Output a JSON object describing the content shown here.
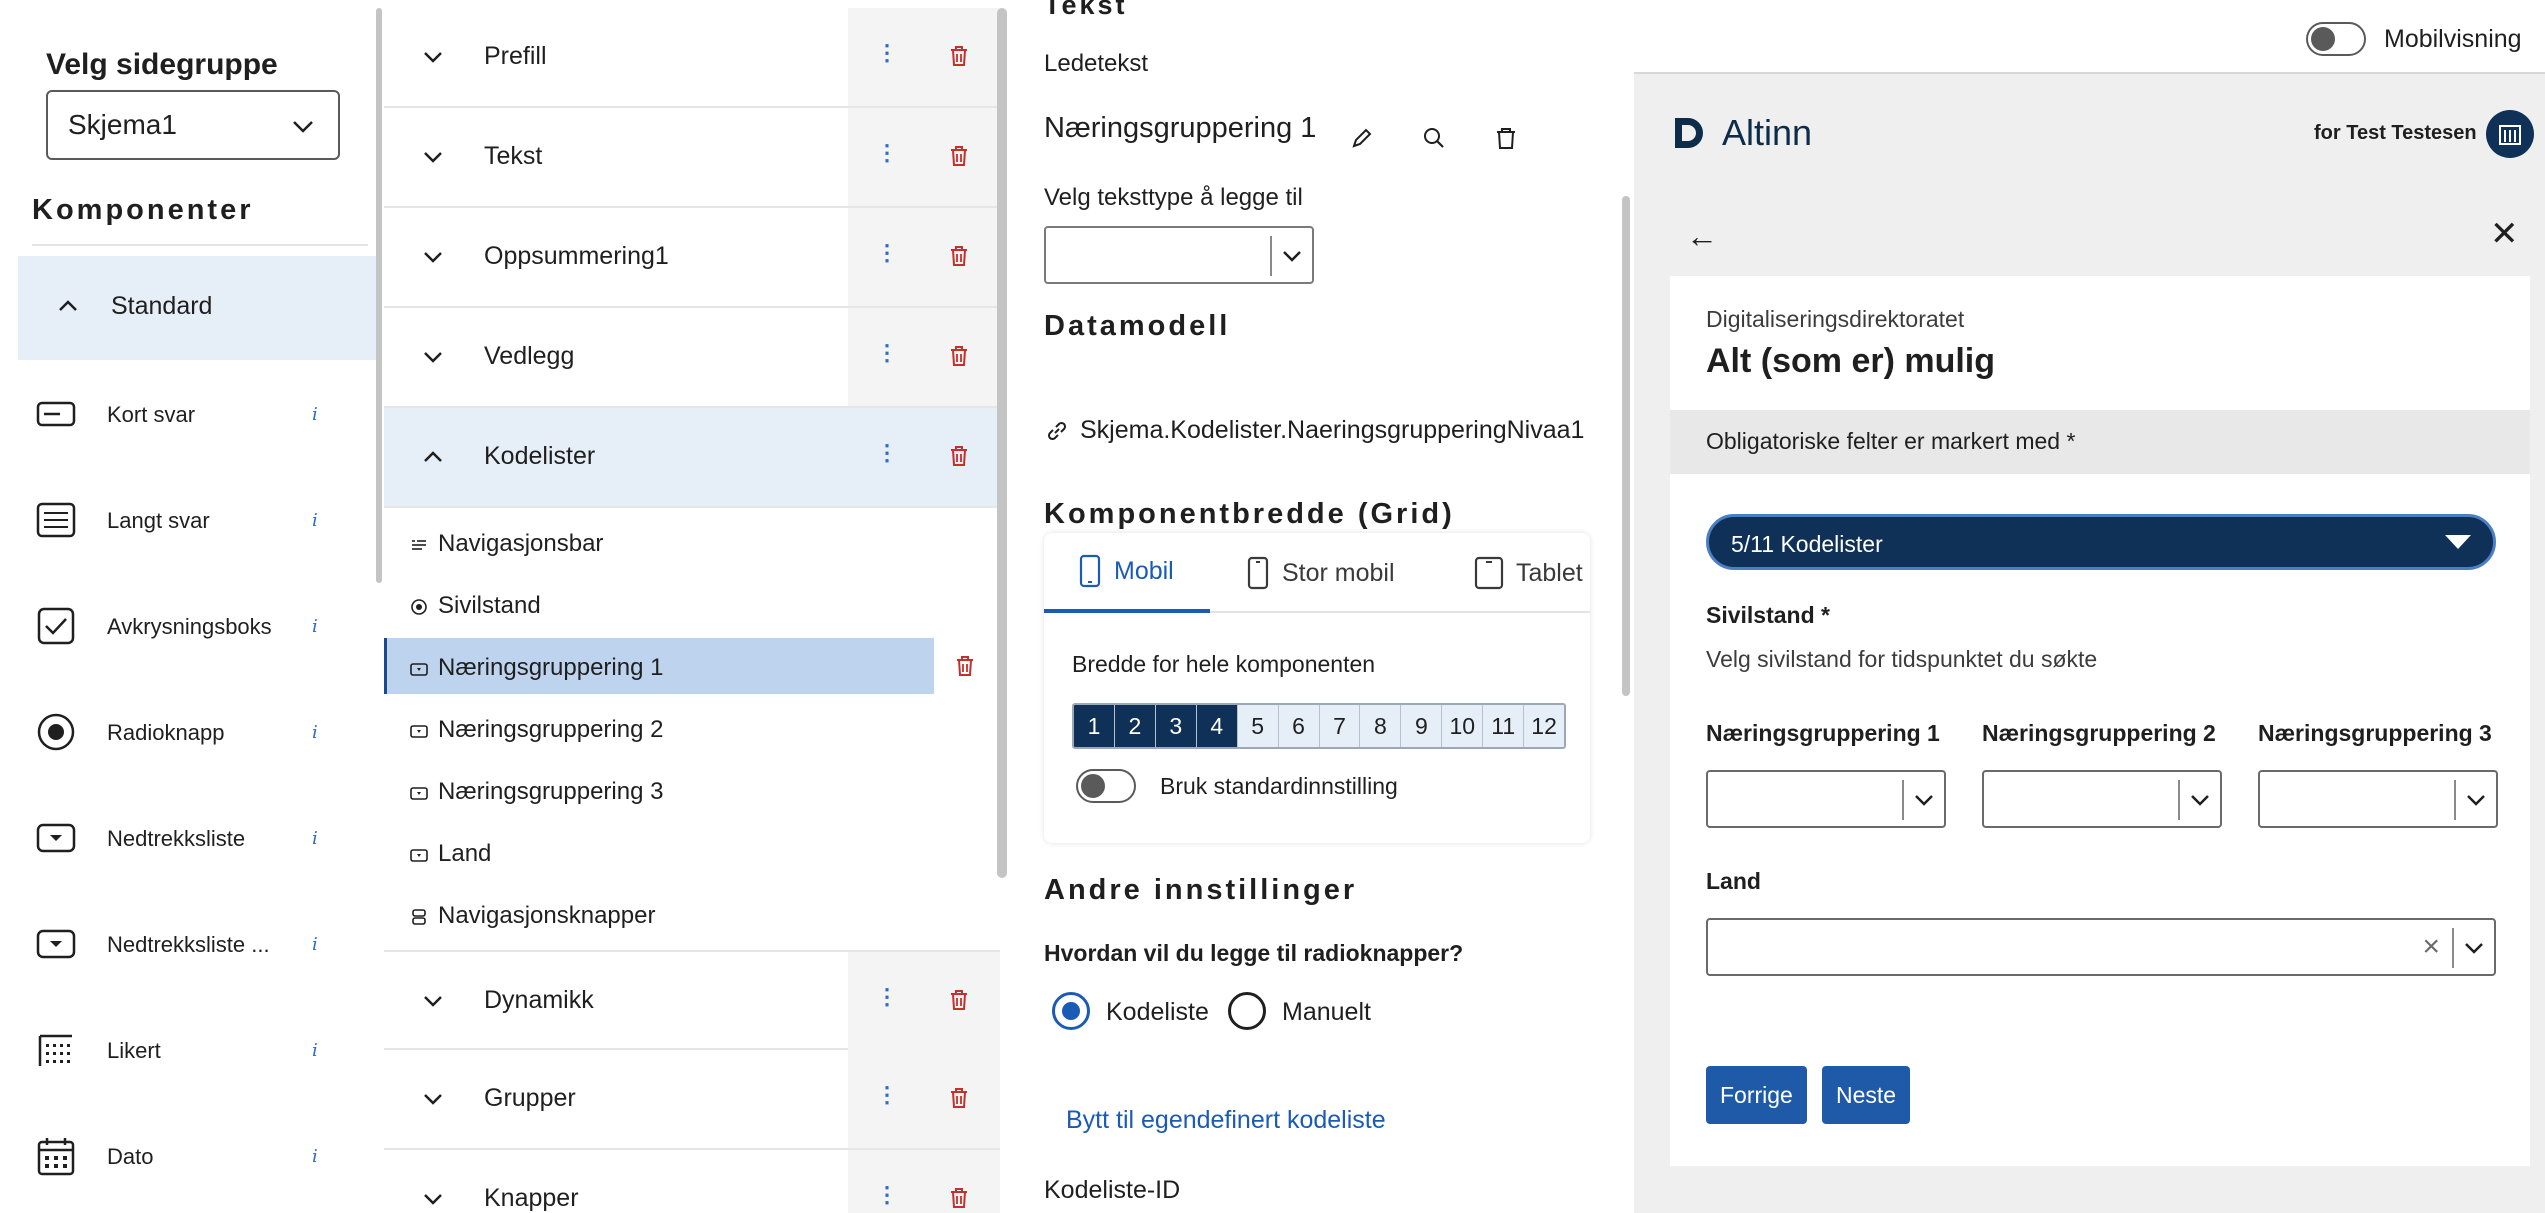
{
  "left_panel": {
    "page_group_title": "Velg sidegruppe",
    "page_group_value": "Skjema1",
    "components_title": "Komponenter",
    "standard_group_label": "Standard",
    "items": [
      {
        "label": "Kort svar",
        "icon": "short-answer-icon",
        "info": "i"
      },
      {
        "label": "Langt svar",
        "icon": "long-answer-icon",
        "info": "i"
      },
      {
        "label": "Avkrysningsboks",
        "icon": "checkbox-icon",
        "info": "i"
      },
      {
        "label": "Radioknapp",
        "icon": "radio-icon",
        "info": "i"
      },
      {
        "label": "Nedtrekksliste",
        "icon": "dropdown-icon",
        "info": "i"
      },
      {
        "label": "Nedtrekksliste ...",
        "icon": "dropdown-icon",
        "info": "i"
      },
      {
        "label": "Likert",
        "icon": "likert-icon",
        "info": "i"
      },
      {
        "label": "Dato",
        "icon": "calendar-icon",
        "info": "i"
      }
    ]
  },
  "tree": {
    "groups_top": [
      {
        "label": "Prefill"
      },
      {
        "label": "Tekst"
      },
      {
        "label": "Oppsummering1"
      },
      {
        "label": "Vedlegg"
      },
      {
        "label": "Kodelister"
      }
    ],
    "children": [
      {
        "label": "Navigasjonsbar",
        "icon": "navbar-icon"
      },
      {
        "label": "Sivilstand",
        "icon": "radio-icon"
      },
      {
        "label": "Næringsgruppering 1",
        "icon": "dropdown-icon"
      },
      {
        "label": "Næringsgruppering 2",
        "icon": "dropdown-icon"
      },
      {
        "label": "Næringsgruppering 3",
        "icon": "dropdown-icon"
      },
      {
        "label": "Land",
        "icon": "dropdown-icon"
      },
      {
        "label": "Navigasjonsknapper",
        "icon": "nav-buttons-icon"
      }
    ],
    "groups_bottom": [
      {
        "label": "Dynamikk"
      },
      {
        "label": "Grupper"
      },
      {
        "label": "Knapper"
      }
    ]
  },
  "props": {
    "clipped_header": "Tekst",
    "ledetekst_label": "Ledetekst",
    "ledetekst_value": "Næringsgruppering 1",
    "text_type_label": "Velg teksttype å legge til",
    "datamodel_title": "Datamodell",
    "datamodel_binding": "Skjema.Kodelister.NaeringsgrupperingNivaa1",
    "grid_title": "Komponentbredde (Grid)",
    "grid_tabs": [
      "Mobil",
      "Stor mobil",
      "Tablet"
    ],
    "grid_width_label": "Bredde for hele komponenten",
    "grid_cells": [
      "1",
      "2",
      "3",
      "4",
      "5",
      "6",
      "7",
      "8",
      "9",
      "10",
      "11",
      "12"
    ],
    "grid_selected": 4,
    "standard_toggle_label": "Bruk standardinnstilling",
    "other_title": "Andre innstillinger",
    "radio_question": "Hvordan vil du legge til radioknapper?",
    "radio_options": [
      "Kodeliste",
      "Manuelt"
    ],
    "switch_link": "Bytt til egendefinert kodeliste",
    "kodeliste_id_label": "Kodeliste-ID"
  },
  "preview": {
    "mobile_toggle_label": "Mobilvisning",
    "brand": "Altinn",
    "user": "for Test Testesen",
    "org": "Digitaliseringsdirektoratet",
    "title": "Alt (som er) mulig",
    "required_note": "Obligatoriske felter er markert med *",
    "nav_select": "5/11 Kodelister",
    "sivilstand_label": "Sivilstand *",
    "sivilstand_desc": "Velg sivilstand for tidspunktet du søkte",
    "ng_labels": [
      "Næringsgruppering 1",
      "Næringsgruppering 2",
      "Næringsgruppering 3"
    ],
    "land_label": "Land",
    "btn_prev": "Forrige",
    "btn_next": "Neste"
  },
  "colors": {
    "accent": "#1a5bb5",
    "dark_navy": "#0f3057",
    "selected_bg": "#bdd3ee",
    "group_bg": "#e6eef8",
    "delete_red": "#c4302b"
  }
}
